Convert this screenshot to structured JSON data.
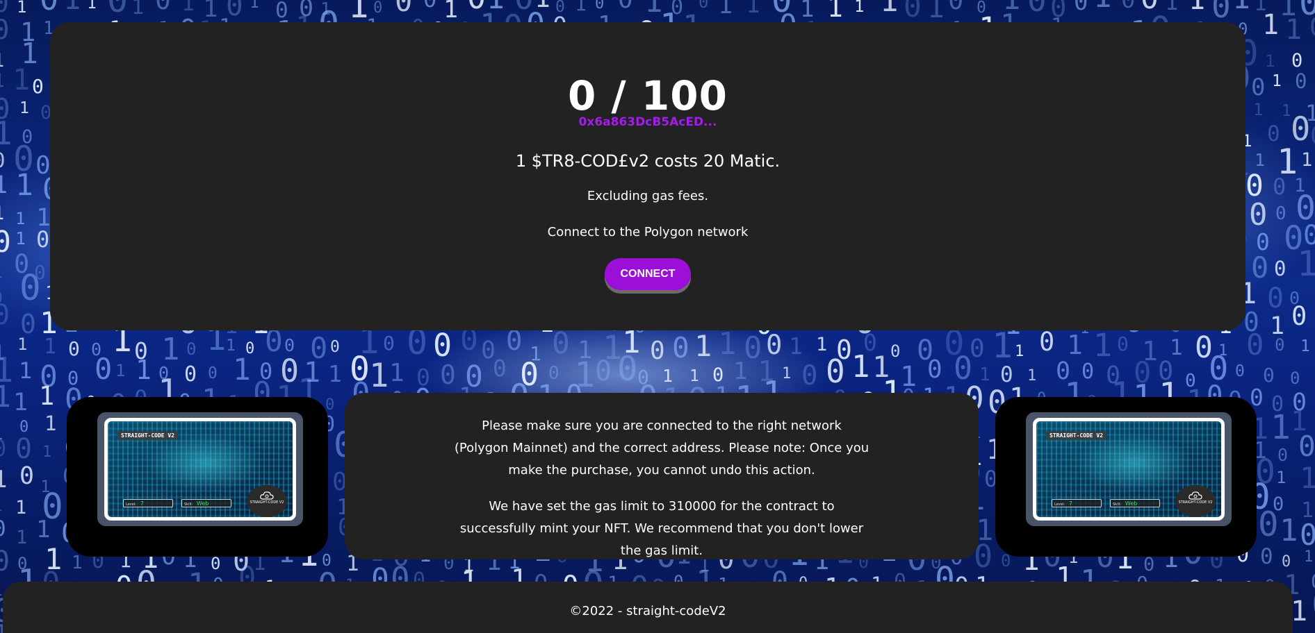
{
  "mint": {
    "count": "0 / 100",
    "contract_address": "0x6a863DcB5AcED...",
    "price_text": "1 $TR8-COD£v2 costs 20 Matic.",
    "gas_note": "Excluding gas fees.",
    "network_note": "Connect to the Polygon network",
    "connect_label": "CONNECT"
  },
  "nft_card": {
    "title": "STRAIGHT-CODE V2",
    "level_label": "Level:",
    "level_value": "7",
    "skill_label": "Skill:",
    "skill_value": "Web",
    "logo_text": "STRAIGHT-CODE V2"
  },
  "info": {
    "paragraph_1": "Please make sure you are connected to the right network (Polygon Mainnet) and the correct address. Please note: Once you make the purchase, you cannot undo this action.",
    "paragraph_2": "We have set the gas limit to 310000 for the contract to successfully mint your NFT. We recommend that you don't lower the gas limit."
  },
  "footer": {
    "text": "©2022 - straight-codeV2"
  },
  "colors": {
    "panel": "#222222",
    "accent": "#9b0fd9",
    "address": "#a01ee6"
  }
}
